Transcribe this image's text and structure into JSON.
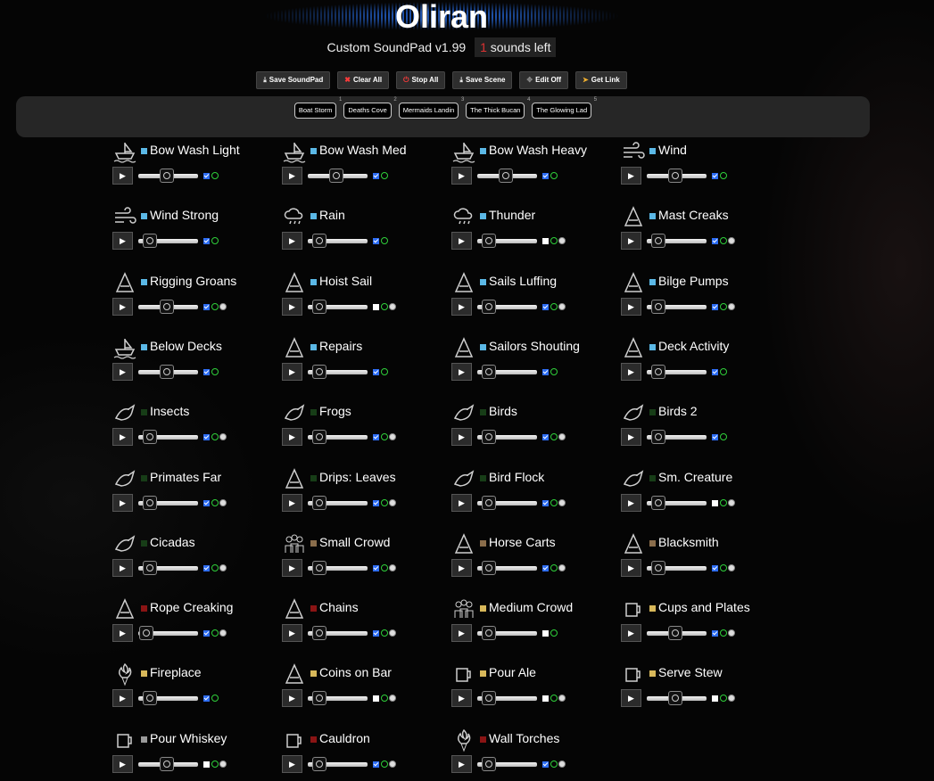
{
  "app": {
    "title": "Oliran",
    "subtitle": "Custom SoundPad v1.99",
    "sounds_left_count": "1",
    "sounds_left_label": "sounds left"
  },
  "toolbar": [
    {
      "label": "Save SoundPad",
      "icon": "download-icon",
      "glyph": "⤓",
      "color": "#ffffff"
    },
    {
      "label": "Clear All",
      "icon": "x-icon",
      "glyph": "✖",
      "color": "#ff3b3b"
    },
    {
      "label": "Stop All",
      "icon": "power-icon",
      "glyph": "⏻",
      "color": "#ff3b3b"
    },
    {
      "label": "Save Scene",
      "icon": "download-icon",
      "glyph": "⤓",
      "color": "#ffffff"
    },
    {
      "label": "Edit Off",
      "icon": "move-icon",
      "glyph": "✥",
      "color": "#888888"
    },
    {
      "label": "Get Link",
      "icon": "send-icon",
      "glyph": "➤",
      "color": "#f0b030"
    }
  ],
  "scenes": [
    {
      "label": "Boat Storm",
      "num": "1"
    },
    {
      "label": "Deaths Cove",
      "num": "2"
    },
    {
      "label": "Mermaids Landin",
      "num": "3"
    },
    {
      "label": "The Thick Bucan",
      "num": "4"
    },
    {
      "label": "The Glowing Lad",
      "num": "5"
    }
  ],
  "swatch_colors": {
    "blue": "#5bb8e6",
    "green": "#173d17",
    "brown": "#8a6d4b",
    "red": "#8a1414",
    "yellow": "#d8b85a",
    "gray": "#9a9a9a"
  },
  "sounds": [
    {
      "name": "Bow Wash Light",
      "icon": "boat-icon",
      "swatch": "blue",
      "volume": 0.45,
      "checked": true,
      "extra": false
    },
    {
      "name": "Bow Wash Med",
      "icon": "boat-icon",
      "swatch": "blue",
      "volume": 0.45,
      "checked": true,
      "extra": false
    },
    {
      "name": "Bow Wash Heavy",
      "icon": "boat-icon",
      "swatch": "blue",
      "volume": 0.45,
      "checked": true,
      "extra": false
    },
    {
      "name": "Wind",
      "icon": "wind-icon",
      "swatch": "blue",
      "volume": 0.45,
      "checked": true,
      "extra": false
    },
    {
      "name": "Wind Strong",
      "icon": "wind-icon",
      "swatch": "blue",
      "volume": 0.1,
      "checked": true,
      "extra": false
    },
    {
      "name": "Rain",
      "icon": "rain-cloud-icon",
      "swatch": "blue",
      "volume": 0.1,
      "checked": true,
      "extra": false
    },
    {
      "name": "Thunder",
      "icon": "thunder-cloud-icon",
      "swatch": "blue",
      "volume": 0.1,
      "checked": false,
      "extra": true
    },
    {
      "name": "Mast Creaks",
      "icon": "mast-icon",
      "swatch": "blue",
      "volume": 0.1,
      "checked": true,
      "extra": true
    },
    {
      "name": "Rigging Groans",
      "icon": "rigging-icon",
      "swatch": "blue",
      "volume": 0.45,
      "checked": true,
      "extra": true
    },
    {
      "name": "Hoist Sail",
      "icon": "sail-icon",
      "swatch": "blue",
      "volume": 0.1,
      "checked": false,
      "extra": true
    },
    {
      "name": "Sails Luffing",
      "icon": "sail-icon",
      "swatch": "blue",
      "volume": 0.1,
      "checked": true,
      "extra": true
    },
    {
      "name": "Bilge Pumps",
      "icon": "pump-icon",
      "swatch": "blue",
      "volume": 0.1,
      "checked": true,
      "extra": true
    },
    {
      "name": "Below Decks",
      "icon": "ship-hull-icon",
      "swatch": "blue",
      "volume": 0.45,
      "checked": true,
      "extra": false
    },
    {
      "name": "Repairs",
      "icon": "hammer-icon",
      "swatch": "blue",
      "volume": 0.1,
      "checked": true,
      "extra": false
    },
    {
      "name": "Sailors Shouting",
      "icon": "shouting-head-icon",
      "swatch": "blue",
      "volume": 0.1,
      "checked": true,
      "extra": false
    },
    {
      "name": "Deck Activity",
      "icon": "shouting-head-icon",
      "swatch": "blue",
      "volume": 0.1,
      "checked": true,
      "extra": false
    },
    {
      "name": "Insects",
      "icon": "insects-icon",
      "swatch": "green",
      "volume": 0.1,
      "checked": true,
      "extra": true
    },
    {
      "name": "Frogs",
      "icon": "frog-icon",
      "swatch": "green",
      "volume": 0.1,
      "checked": true,
      "extra": true
    },
    {
      "name": "Birds",
      "icon": "bird-icon",
      "swatch": "green",
      "volume": 0.1,
      "checked": true,
      "extra": true
    },
    {
      "name": "Birds 2",
      "icon": "bird-icon",
      "swatch": "green",
      "volume": 0.1,
      "checked": true,
      "extra": false
    },
    {
      "name": "Primates Far",
      "icon": "gorilla-icon",
      "swatch": "green",
      "volume": 0.1,
      "checked": true,
      "extra": true
    },
    {
      "name": "Drips: Leaves",
      "icon": "leaves-icon",
      "swatch": "green",
      "volume": 0.1,
      "checked": true,
      "extra": true
    },
    {
      "name": "Bird Flock",
      "icon": "bird-flock-icon",
      "swatch": "green",
      "volume": 0.1,
      "checked": true,
      "extra": true
    },
    {
      "name": "Sm. Creature",
      "icon": "rodent-icon",
      "swatch": "green",
      "volume": 0.1,
      "checked": false,
      "extra": true
    },
    {
      "name": "Cicadas",
      "icon": "cicada-icon",
      "swatch": "green",
      "volume": 0.1,
      "checked": true,
      "extra": true
    },
    {
      "name": "Small Crowd",
      "icon": "crowd-icon",
      "swatch": "brown",
      "volume": 0.1,
      "checked": true,
      "extra": true
    },
    {
      "name": "Horse Carts",
      "icon": "horseshoe-icon",
      "swatch": "brown",
      "volume": 0.1,
      "checked": true,
      "extra": true
    },
    {
      "name": "Blacksmith",
      "icon": "anvil-icon",
      "swatch": "brown",
      "volume": 0.1,
      "checked": true,
      "extra": true
    },
    {
      "name": "Rope Creaking",
      "icon": "noose-icon",
      "swatch": "red",
      "volume": 0.02,
      "checked": true,
      "extra": true
    },
    {
      "name": "Chains",
      "icon": "chain-icon",
      "swatch": "red",
      "volume": 0.1,
      "checked": true,
      "extra": true
    },
    {
      "name": "Medium Crowd",
      "icon": "crowd-icon",
      "swatch": "yellow",
      "volume": 0.1,
      "checked": false,
      "extra": false
    },
    {
      "name": "Cups and Plates",
      "icon": "mug-icon",
      "swatch": "yellow",
      "volume": 0.45,
      "checked": true,
      "extra": true
    },
    {
      "name": "Fireplace",
      "icon": "fireplace-icon",
      "swatch": "yellow",
      "volume": 0.1,
      "checked": true,
      "extra": false
    },
    {
      "name": "Coins on Bar",
      "icon": "coins-icon",
      "swatch": "yellow",
      "volume": 0.1,
      "checked": false,
      "extra": true
    },
    {
      "name": "Pour Ale",
      "icon": "ale-mug-icon",
      "swatch": "yellow",
      "volume": 0.1,
      "checked": false,
      "extra": true
    },
    {
      "name": "Serve Stew",
      "icon": "stew-bowl-icon",
      "swatch": "yellow",
      "volume": 0.45,
      "checked": false,
      "extra": true
    },
    {
      "name": "Pour Whiskey",
      "icon": "bottle-icon",
      "swatch": "gray",
      "volume": 0.45,
      "checked": false,
      "extra": true
    },
    {
      "name": "Cauldron",
      "icon": "cauldron-icon",
      "swatch": "red",
      "volume": 0.1,
      "checked": true,
      "extra": true
    },
    {
      "name": "Wall Torches",
      "icon": "torch-icon",
      "swatch": "red",
      "volume": 0.1,
      "checked": true,
      "extra": true
    }
  ]
}
